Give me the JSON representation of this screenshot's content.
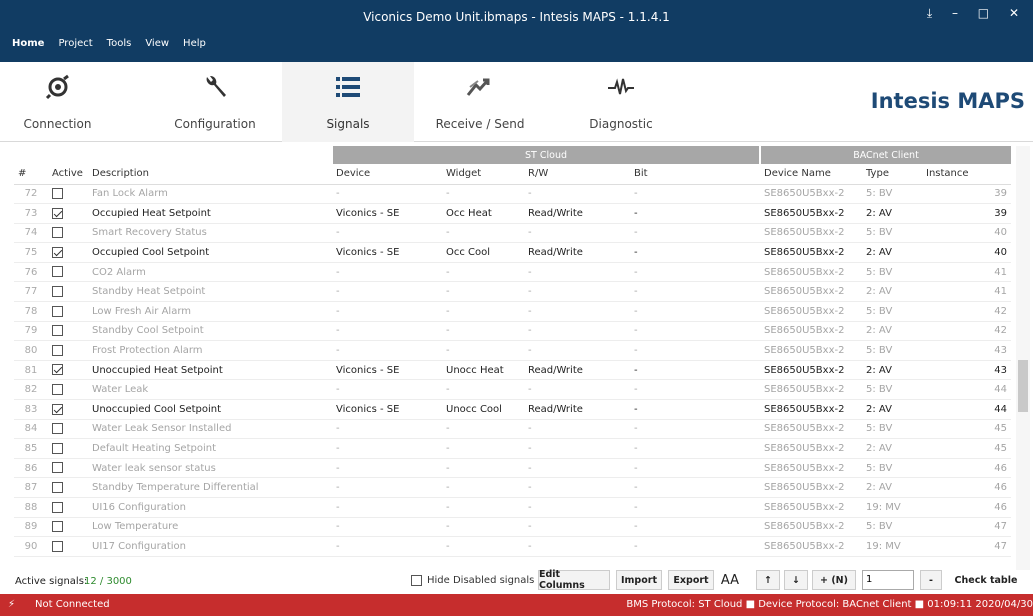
{
  "window": {
    "title": "Viconics Demo Unit.ibmaps - Intesis MAPS - 1.1.4.1",
    "controls": "⤓ – □ ✕"
  },
  "menu": [
    "Home",
    "Project",
    "Tools",
    "View",
    "Help"
  ],
  "ribbon": {
    "tabs": [
      {
        "label": "Connection",
        "icon": "connection-icon"
      },
      {
        "label": "Configuration",
        "icon": "wrench-icon"
      },
      {
        "label": "Signals",
        "icon": "list-icon"
      },
      {
        "label": "Receive / Send",
        "icon": "transfer-icon"
      },
      {
        "label": "Diagnostic",
        "icon": "pulse-icon"
      }
    ],
    "brand": "Intesis MAPS"
  },
  "table": {
    "groups": {
      "st": "ST Cloud",
      "bac": "BACnet Client"
    },
    "headers": [
      "#",
      "Active",
      "Description",
      "Device",
      "Widget",
      "R/W",
      "Bit",
      "Device Name",
      "Type",
      "Instance"
    ],
    "rows": [
      {
        "n": "72",
        "on": false,
        "desc": "Fan Lock Alarm",
        "dev": "-",
        "wid": "-",
        "rw": "-",
        "bit": "-",
        "dname": "SE8650U5Bxx-2",
        "type": "5: BV",
        "inst": "39"
      },
      {
        "n": "73",
        "on": true,
        "desc": "Occupied Heat Setpoint",
        "dev": "Viconics - SE",
        "wid": "Occ Heat",
        "rw": "Read/Write",
        "bit": "-",
        "dname": "SE8650U5Bxx-2",
        "type": "2: AV",
        "inst": "39"
      },
      {
        "n": "74",
        "on": false,
        "desc": "Smart Recovery Status",
        "dev": "-",
        "wid": "-",
        "rw": "-",
        "bit": "-",
        "dname": "SE8650U5Bxx-2",
        "type": "5: BV",
        "inst": "40"
      },
      {
        "n": "75",
        "on": true,
        "desc": "Occupied Cool Setpoint",
        "dev": "Viconics - SE",
        "wid": "Occ Cool",
        "rw": "Read/Write",
        "bit": "-",
        "dname": "SE8650U5Bxx-2",
        "type": "2: AV",
        "inst": "40"
      },
      {
        "n": "76",
        "on": false,
        "desc": "CO2 Alarm",
        "dev": "-",
        "wid": "-",
        "rw": "-",
        "bit": "-",
        "dname": "SE8650U5Bxx-2",
        "type": "5: BV",
        "inst": "41"
      },
      {
        "n": "77",
        "on": false,
        "desc": "Standby Heat Setpoint",
        "dev": "-",
        "wid": "-",
        "rw": "-",
        "bit": "-",
        "dname": "SE8650U5Bxx-2",
        "type": "2: AV",
        "inst": "41"
      },
      {
        "n": "78",
        "on": false,
        "desc": "Low Fresh Air Alarm",
        "dev": "-",
        "wid": "-",
        "rw": "-",
        "bit": "-",
        "dname": "SE8650U5Bxx-2",
        "type": "5: BV",
        "inst": "42"
      },
      {
        "n": "79",
        "on": false,
        "desc": "Standby Cool Setpoint",
        "dev": "-",
        "wid": "-",
        "rw": "-",
        "bit": "-",
        "dname": "SE8650U5Bxx-2",
        "type": "2: AV",
        "inst": "42"
      },
      {
        "n": "80",
        "on": false,
        "desc": "Frost Protection Alarm",
        "dev": "-",
        "wid": "-",
        "rw": "-",
        "bit": "-",
        "dname": "SE8650U5Bxx-2",
        "type": "5: BV",
        "inst": "43"
      },
      {
        "n": "81",
        "on": true,
        "desc": "Unoccupied Heat Setpoint",
        "dev": "Viconics - SE",
        "wid": "Unocc Heat",
        "rw": "Read/Write",
        "bit": "-",
        "dname": "SE8650U5Bxx-2",
        "type": "2: AV",
        "inst": "43"
      },
      {
        "n": "82",
        "on": false,
        "desc": "Water Leak",
        "dev": "-",
        "wid": "-",
        "rw": "-",
        "bit": "-",
        "dname": "SE8650U5Bxx-2",
        "type": "5: BV",
        "inst": "44"
      },
      {
        "n": "83",
        "on": true,
        "desc": "Unoccupied Cool Setpoint",
        "dev": "Viconics - SE",
        "wid": "Unocc Cool",
        "rw": "Read/Write",
        "bit": "-",
        "dname": "SE8650U5Bxx-2",
        "type": "2: AV",
        "inst": "44"
      },
      {
        "n": "84",
        "on": false,
        "desc": "Water Leak Sensor Installed",
        "dev": "-",
        "wid": "-",
        "rw": "-",
        "bit": "-",
        "dname": "SE8650U5Bxx-2",
        "type": "5: BV",
        "inst": "45"
      },
      {
        "n": "85",
        "on": false,
        "desc": "Default Heating Setpoint",
        "dev": "-",
        "wid": "-",
        "rw": "-",
        "bit": "-",
        "dname": "SE8650U5Bxx-2",
        "type": "2: AV",
        "inst": "45"
      },
      {
        "n": "86",
        "on": false,
        "desc": "Water leak sensor status",
        "dev": "-",
        "wid": "-",
        "rw": "-",
        "bit": "-",
        "dname": "SE8650U5Bxx-2",
        "type": "5: BV",
        "inst": "46"
      },
      {
        "n": "87",
        "on": false,
        "desc": "Standby Temperature Differential",
        "dev": "-",
        "wid": "-",
        "rw": "-",
        "bit": "-",
        "dname": "SE8650U5Bxx-2",
        "type": "2: AV",
        "inst": "46"
      },
      {
        "n": "88",
        "on": false,
        "desc": "UI16 Configuration",
        "dev": "-",
        "wid": "-",
        "rw": "-",
        "bit": "-",
        "dname": "SE8650U5Bxx-2",
        "type": "19: MV",
        "inst": "46"
      },
      {
        "n": "89",
        "on": false,
        "desc": "Low Temperature",
        "dev": "-",
        "wid": "-",
        "rw": "-",
        "bit": "-",
        "dname": "SE8650U5Bxx-2",
        "type": "5: BV",
        "inst": "47"
      },
      {
        "n": "90",
        "on": false,
        "desc": "UI17 Configuration",
        "dev": "-",
        "wid": "-",
        "rw": "-",
        "bit": "-",
        "dname": "SE8650U5Bxx-2",
        "type": "19: MV",
        "inst": "47"
      }
    ]
  },
  "footer": {
    "active_label": "Active signals:",
    "active_count": "12 / 3000",
    "hide_disabled": "Hide Disabled signals",
    "edit_columns": "Edit Columns",
    "import": "Import",
    "export": "Export",
    "font_size": "AA",
    "up": "↑",
    "down": "↓",
    "plus_n": "+ (N)",
    "n_value": "1",
    "minus": "-",
    "check_table": "Check table"
  },
  "status": {
    "connection": "Not Connected",
    "right": "BMS Protocol: ST Cloud  ■  Device Protocol: BACnet Client  ■  01:09:11 2020/04/30"
  }
}
